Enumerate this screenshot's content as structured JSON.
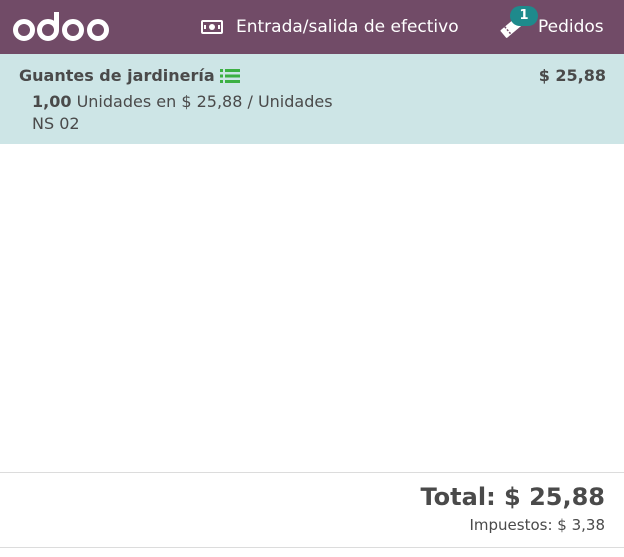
{
  "header": {
    "logo_text": "odoo",
    "cash_label": "Entrada/salida de efectivo",
    "orders_label": "Pedidos",
    "orders_count": "1"
  },
  "orderline": {
    "product_name": "Guantes de jardinería",
    "price": "$ 25,88",
    "quantity": "1,00",
    "unit_info": " Unidades en $ 25,88 / Unidades",
    "lot": "NS 02"
  },
  "summary": {
    "total": "Total: $ 25,88",
    "taxes": "Impuestos: $ 3,38"
  },
  "colors": {
    "topbar": "#714b67",
    "selected_line": "#cde5e6",
    "badge": "#1e8a8c",
    "lot_icon": "#3cb043"
  },
  "icons": {
    "cash": "money-bill-icon",
    "orders": "ticket-icon",
    "lot": "list-icon"
  }
}
